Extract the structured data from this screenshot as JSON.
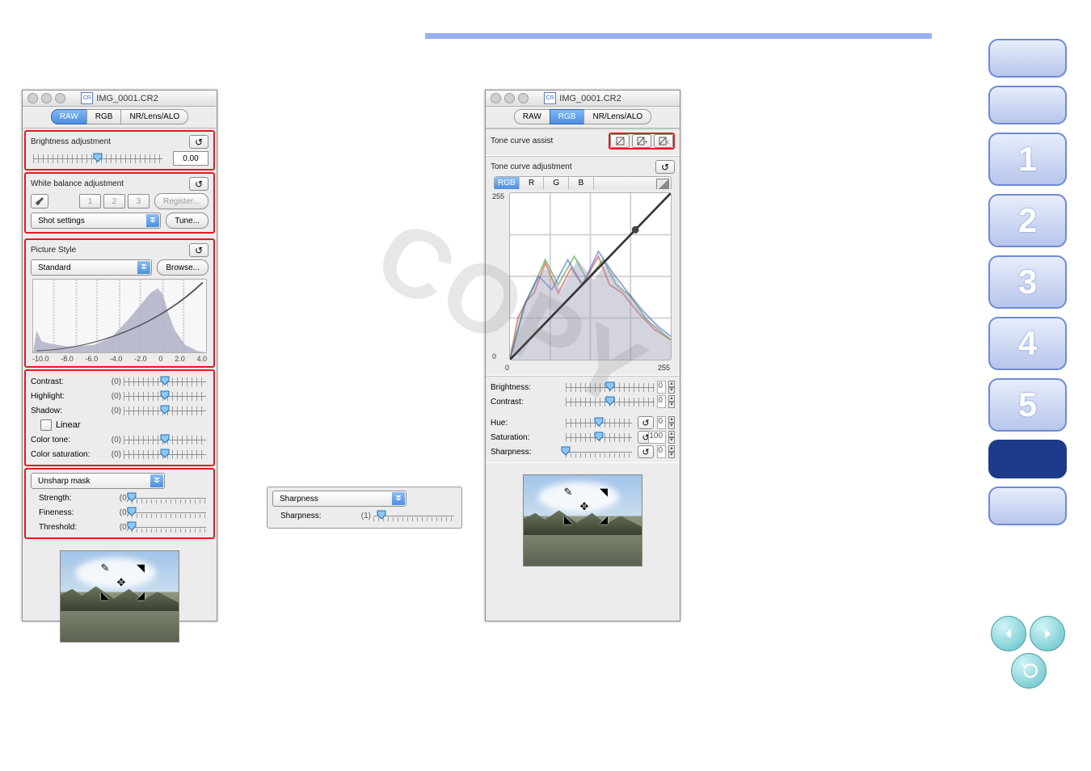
{
  "panel_raw": {
    "filename": "IMG_0001.CR2",
    "tabs": [
      "RAW",
      "RGB",
      "NR/Lens/ALO"
    ],
    "active_tab": 0,
    "brightness": {
      "label": "Brightness adjustment",
      "value": "0.00"
    },
    "white_balance": {
      "label": "White balance adjustment",
      "presets": [
        "1",
        "2",
        "3"
      ],
      "register": "Register...",
      "shot_settings": "Shot settings",
      "tune": "Tune..."
    },
    "picture_style": {
      "label": "Picture Style",
      "value": "Standard",
      "browse": "Browse..."
    },
    "histogram_axis": [
      "-10.0",
      "-8.0",
      "-6.0",
      "-4.0",
      "-2.0",
      "0",
      "2.0",
      "4.0"
    ],
    "params": {
      "contrast": {
        "label": "Contrast:",
        "value": "(0)"
      },
      "highlight": {
        "label": "Highlight:",
        "value": "(0)"
      },
      "shadow": {
        "label": "Shadow:",
        "value": "(0)"
      },
      "linear": "Linear",
      "color_tone": {
        "label": "Color tone:",
        "value": "(0)"
      },
      "color_saturation": {
        "label": "Color saturation:",
        "value": "(0)"
      }
    },
    "unsharp": {
      "mode": "Unsharp mask",
      "strength": {
        "label": "Strength:",
        "value": "(0)"
      },
      "fineness": {
        "label": "Fineness:",
        "value": "(0)"
      },
      "threshold": {
        "label": "Threshold:",
        "value": "(0)"
      }
    }
  },
  "detached": {
    "mode": "Sharpness",
    "sharpness": {
      "label": "Sharpness:",
      "value": "(1)"
    }
  },
  "panel_rgb": {
    "filename": "IMG_0001.CR2",
    "tabs": [
      "RAW",
      "RGB",
      "NR/Lens/ALO"
    ],
    "active_tab": 1,
    "tone_assist": "Tone curve assist",
    "tone_adjust": "Tone curve adjustment",
    "channels": [
      "RGB",
      "R",
      "G",
      "B"
    ],
    "curve_min": "0",
    "curve_max": "255",
    "params": {
      "brightness": {
        "label": "Brightness:",
        "value": "0"
      },
      "contrast": {
        "label": "Contrast:",
        "value": "0"
      },
      "hue": {
        "label": "Hue:",
        "value": "0"
      },
      "saturation": {
        "label": "Saturation:",
        "value": "100"
      },
      "sharpness": {
        "label": "Sharpness:",
        "value": "0"
      }
    }
  },
  "nav": {
    "chapters": [
      "1",
      "2",
      "3",
      "4",
      "5"
    ]
  },
  "watermark": "COPY"
}
